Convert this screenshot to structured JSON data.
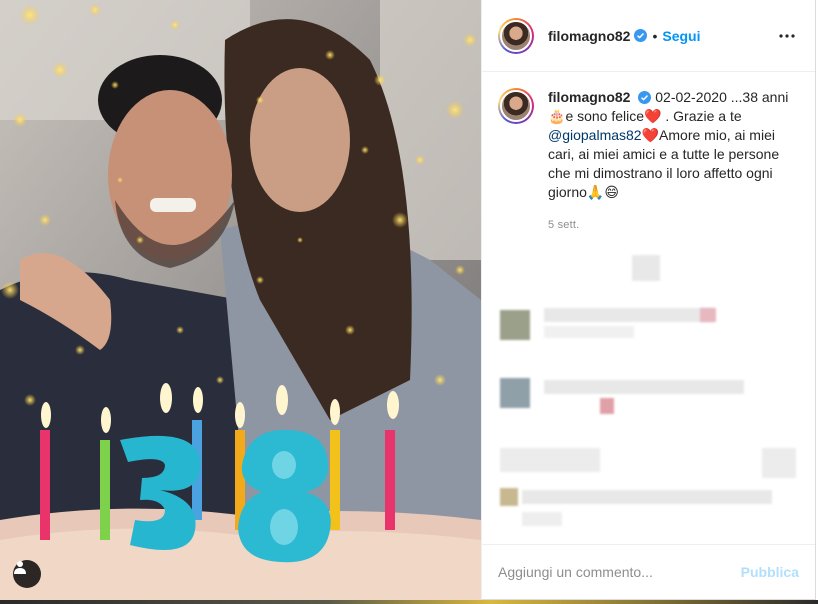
{
  "post": {
    "photo_alt_icon": "user-tag-icon",
    "author": {
      "username": "filomagno82",
      "verified": true
    },
    "follow_separator": "•",
    "follow_label": "Segui",
    "more_icon": "more-options-icon",
    "caption": {
      "username": "filomagno82",
      "date": "02-02-2020",
      "part1": " ...38 anni ",
      "cake_emoji": "🎂",
      "part2": "e sono felice",
      "heart_emoji": "❤️",
      "part3": " . Grazie a te ",
      "mention": "@giopalmas82",
      "heart_emoji2": "❤️",
      "part4": "Amore mio, ai miei cari, ai miei amici e a tutte le persone che mi dimostrano il loro affetto ogni giorno",
      "end_emojis": "🙏😄"
    },
    "timestamp": "5 sett.",
    "comment_placeholder": "Aggiungi un commento...",
    "publish_label": "Pubblica"
  }
}
